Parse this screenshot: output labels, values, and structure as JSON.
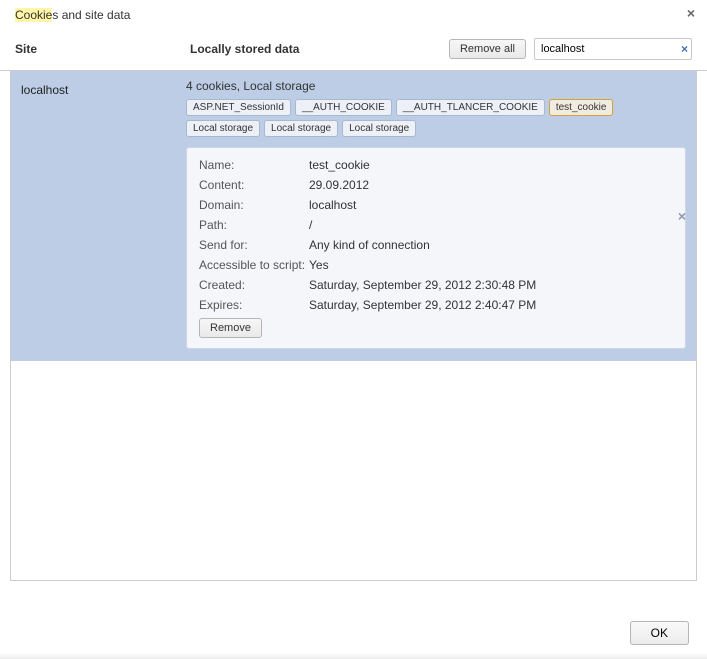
{
  "header": {
    "title_prefix_highlight": "Cookie",
    "title_suffix": "s and site data",
    "close_glyph": "×"
  },
  "toolbar": {
    "site_header": "Site",
    "data_header": "Locally stored data",
    "remove_all_label": "Remove all",
    "search_value": "localhost",
    "search_clear_glyph": "×"
  },
  "site": {
    "name": "localhost",
    "summary": "4 cookies, Local storage",
    "chips": [
      {
        "label": "ASP.NET_SessionId",
        "selected": false
      },
      {
        "label": "__AUTH_COOKIE",
        "selected": false
      },
      {
        "label": "__AUTH_TLANCER_COOKIE",
        "selected": false
      },
      {
        "label": "test_cookie",
        "selected": true
      },
      {
        "label": "Local storage",
        "selected": false
      },
      {
        "label": "Local storage",
        "selected": false
      },
      {
        "label": "Local storage",
        "selected": false
      }
    ],
    "row_close_glyph": "×"
  },
  "detail": {
    "rows": [
      {
        "label": "Name:",
        "value": "test_cookie"
      },
      {
        "label": "Content:",
        "value": "29.09.2012"
      },
      {
        "label": "Domain:",
        "value": "localhost"
      },
      {
        "label": "Path:",
        "value": "/"
      },
      {
        "label": "Send for:",
        "value": "Any kind of connection"
      },
      {
        "label": "Accessible to script:",
        "value": "Yes"
      },
      {
        "label": "Created:",
        "value": "Saturday, September 29, 2012 2:30:48 PM"
      },
      {
        "label": "Expires:",
        "value": "Saturday, September 29, 2012 2:40:47 PM"
      }
    ],
    "remove_label": "Remove"
  },
  "footer": {
    "ok_label": "OK"
  }
}
